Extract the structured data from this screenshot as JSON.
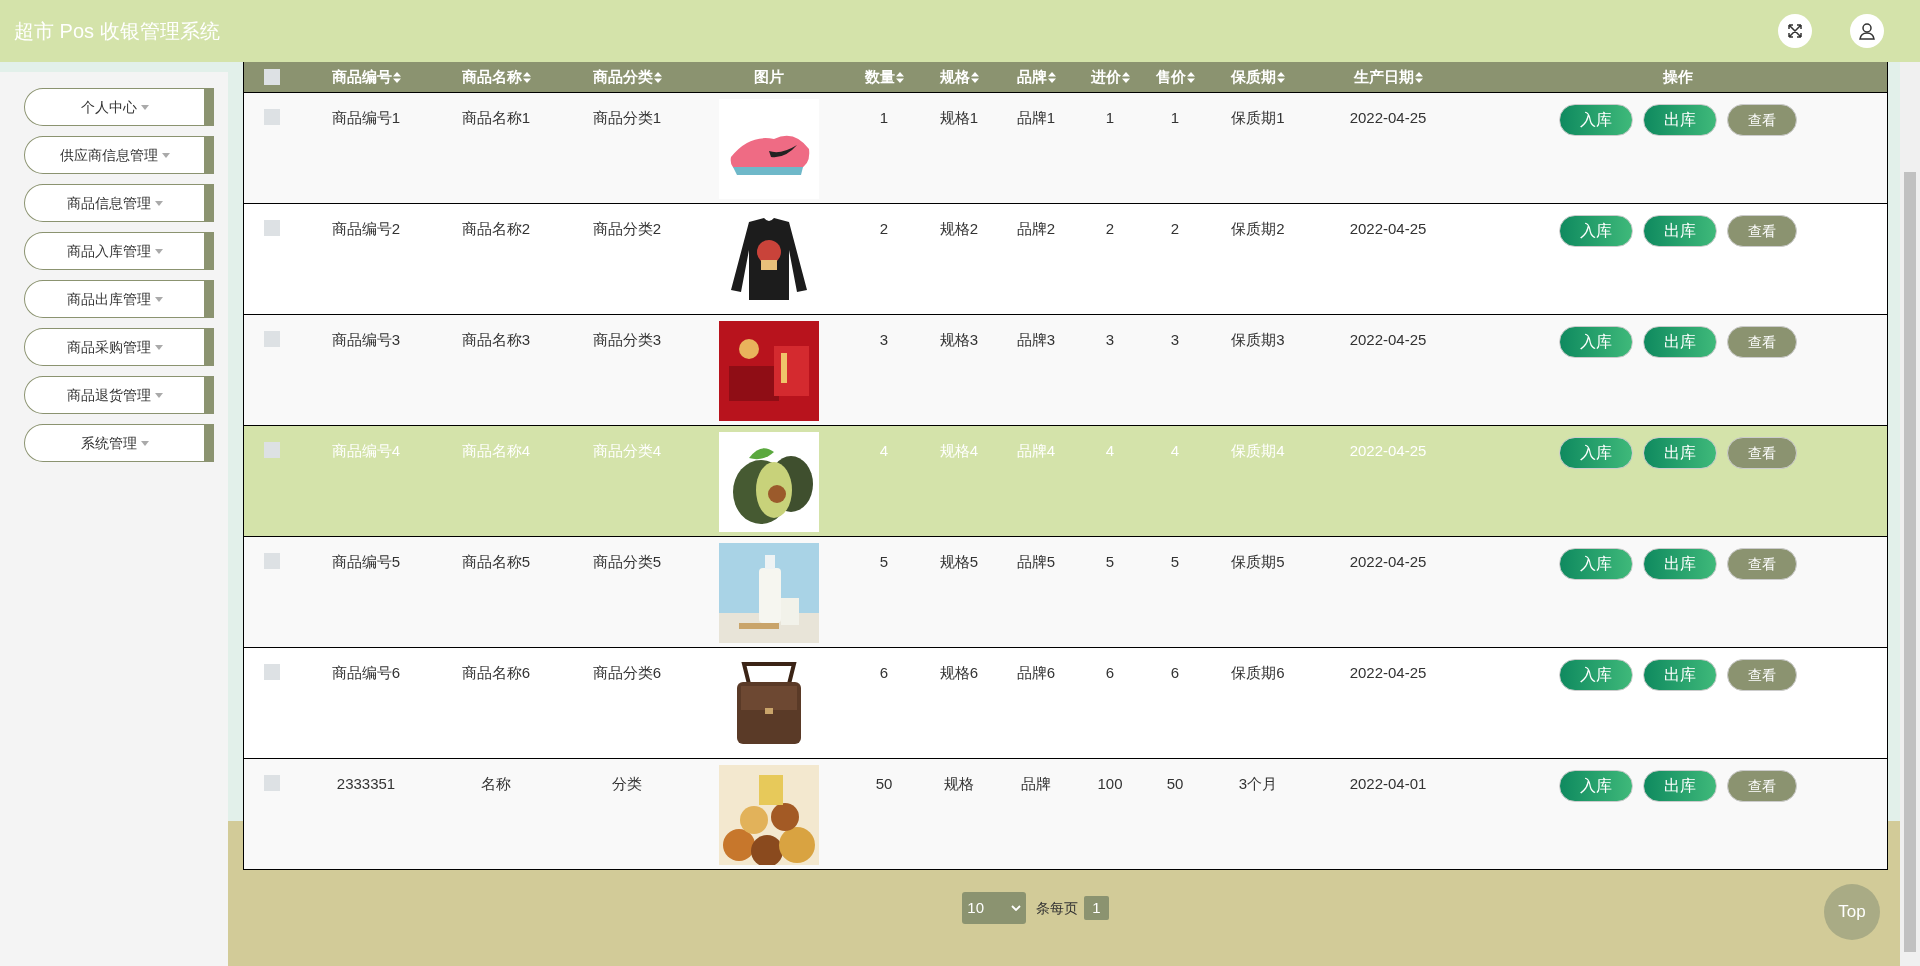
{
  "header": {
    "title": "超市 Pos 收银管理系统"
  },
  "sidebar": {
    "items": [
      {
        "label": "个人中心"
      },
      {
        "label": "供应商信息管理"
      },
      {
        "label": "商品信息管理"
      },
      {
        "label": "商品入库管理"
      },
      {
        "label": "商品出库管理"
      },
      {
        "label": "商品采购管理"
      },
      {
        "label": "商品退货管理"
      },
      {
        "label": "系统管理"
      }
    ]
  },
  "table": {
    "select_all": {
      "checked": false
    },
    "columns": [
      {
        "label": "商品编号",
        "sortable": true
      },
      {
        "label": "商品名称",
        "sortable": true
      },
      {
        "label": "商品分类",
        "sortable": true
      },
      {
        "label": "图片",
        "sortable": false
      },
      {
        "label": "数量",
        "sortable": true
      },
      {
        "label": "规格",
        "sortable": true
      },
      {
        "label": "品牌",
        "sortable": true
      },
      {
        "label": "进价",
        "sortable": true
      },
      {
        "label": "售价",
        "sortable": true
      },
      {
        "label": "保质期",
        "sortable": true
      },
      {
        "label": "生产日期",
        "sortable": true
      },
      {
        "label": "操作",
        "sortable": false
      }
    ],
    "rows": [
      {
        "checked": false,
        "selected": false,
        "cells": [
          "商品编号1",
          "商品名称1",
          "商品分类1"
        ],
        "picture": {
          "kind": "shoe"
        },
        "values": [
          "1",
          "规格1",
          "品牌1",
          "1",
          "1",
          "保质期1",
          "2022-04-25"
        ],
        "actions": [
          {
            "label": "入库",
            "kind": "in"
          },
          {
            "label": "出库",
            "kind": "out"
          },
          {
            "label": "查看",
            "kind": "view"
          }
        ]
      },
      {
        "checked": false,
        "selected": false,
        "cells": [
          "商品编号2",
          "商品名称2",
          "商品分类2"
        ],
        "picture": {
          "kind": "shirt"
        },
        "values": [
          "2",
          "规格2",
          "品牌2",
          "2",
          "2",
          "保质期2",
          "2022-04-25"
        ],
        "actions": [
          {
            "label": "入库",
            "kind": "in"
          },
          {
            "label": "出库",
            "kind": "out"
          },
          {
            "label": "查看",
            "kind": "view"
          }
        ]
      },
      {
        "checked": false,
        "selected": false,
        "cells": [
          "商品编号3",
          "商品名称3",
          "商品分类3"
        ],
        "picture": {
          "kind": "gift"
        },
        "values": [
          "3",
          "规格3",
          "品牌3",
          "3",
          "3",
          "保质期3",
          "2022-04-25"
        ],
        "actions": [
          {
            "label": "入库",
            "kind": "in"
          },
          {
            "label": "出库",
            "kind": "out"
          },
          {
            "label": "查看",
            "kind": "view"
          }
        ]
      },
      {
        "checked": false,
        "selected": true,
        "cells": [
          "商品编号4",
          "商品名称4",
          "商品分类4"
        ],
        "picture": {
          "kind": "fruit"
        },
        "values": [
          "4",
          "规格4",
          "品牌4",
          "4",
          "4",
          "保质期4",
          "2022-04-25"
        ],
        "actions": [
          {
            "label": "入库",
            "kind": "in"
          },
          {
            "label": "出库",
            "kind": "out"
          },
          {
            "label": "查看",
            "kind": "view"
          }
        ]
      },
      {
        "checked": false,
        "selected": false,
        "cells": [
          "商品编号5",
          "商品名称5",
          "商品分类5"
        ],
        "picture": {
          "kind": "milk"
        },
        "values": [
          "5",
          "规格5",
          "品牌5",
          "5",
          "5",
          "保质期5",
          "2022-04-25"
        ],
        "actions": [
          {
            "label": "入库",
            "kind": "in"
          },
          {
            "label": "出库",
            "kind": "out"
          },
          {
            "label": "查看",
            "kind": "view"
          }
        ]
      },
      {
        "checked": false,
        "selected": false,
        "cells": [
          "商品编号6",
          "商品名称6",
          "商品分类6"
        ],
        "picture": {
          "kind": "bag"
        },
        "values": [
          "6",
          "规格6",
          "品牌6",
          "6",
          "6",
          "保质期6",
          "2022-04-25"
        ],
        "actions": [
          {
            "label": "入库",
            "kind": "in"
          },
          {
            "label": "出库",
            "kind": "out"
          },
          {
            "label": "查看",
            "kind": "view"
          }
        ]
      },
      {
        "checked": false,
        "selected": false,
        "cells": [
          "2333351",
          "名称",
          "分类"
        ],
        "picture": {
          "kind": "snacks"
        },
        "values": [
          "50",
          "规格",
          "品牌",
          "100",
          "50",
          "3个月",
          "2022-04-01"
        ],
        "actions": [
          {
            "label": "入库",
            "kind": "in"
          },
          {
            "label": "出库",
            "kind": "out"
          },
          {
            "label": "查看",
            "kind": "view"
          }
        ]
      }
    ]
  },
  "pagination": {
    "page_size": "10",
    "per_page_label": "条每页",
    "page": "1"
  },
  "back_to_top": {
    "label": "Top"
  }
}
